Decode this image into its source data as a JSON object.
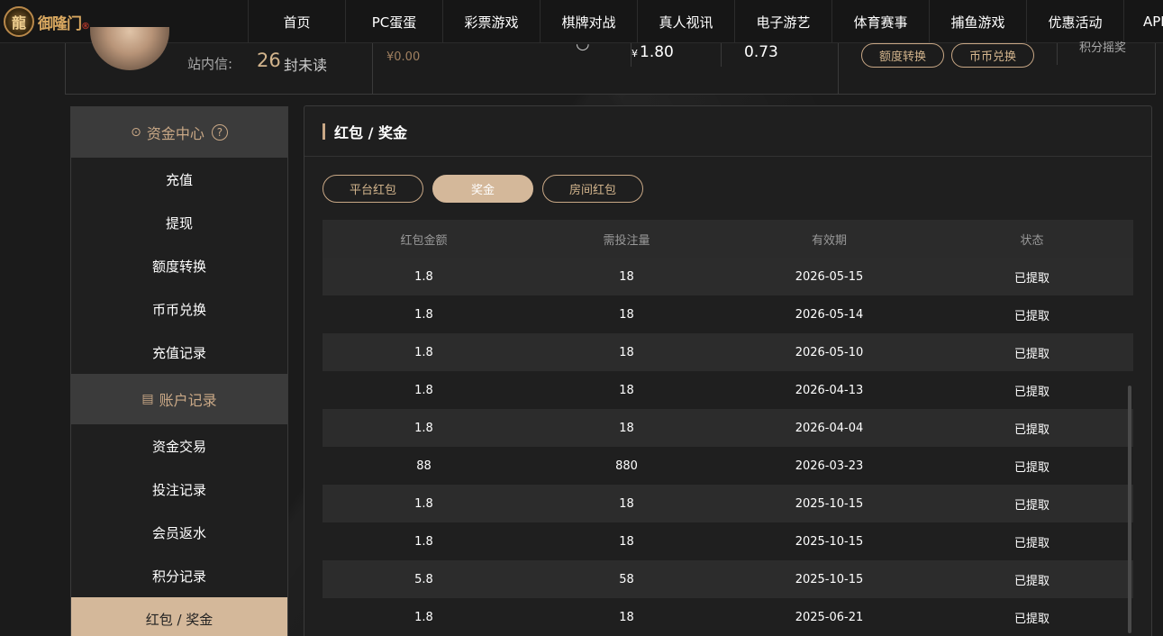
{
  "logo": {
    "mark": "龍",
    "text": "御隆门",
    "tag": "®"
  },
  "nav": [
    "首页",
    "PC蛋蛋",
    "彩票游戏",
    "棋牌对战",
    "真人视讯",
    "电子游艺",
    "体育赛事",
    "捕鱼游戏",
    "优惠活动",
    "APP"
  ],
  "account": {
    "msg_label": "站内信:",
    "msg_count": "26",
    "msg_unread": "封未读",
    "balance_left": "¥0.00",
    "balance_mid_symbol": "¥",
    "balance_mid": "1.80",
    "balance_right": "0.73",
    "btn_transfer": "额度转换",
    "btn_exchange": "币币兑换",
    "points_label": "积分摇奖"
  },
  "sidebar": {
    "fund_center": "资金中心",
    "help": "?",
    "fund_items": [
      "充值",
      "提现",
      "额度转换",
      "币币兑换",
      "充值记录"
    ],
    "account_records": "账户记录",
    "record_items": [
      "资金交易",
      "投注记录",
      "会员返水",
      "积分记录",
      "红包 / 奖金"
    ]
  },
  "panel": {
    "title": "红包 / 奖金",
    "tabs": [
      "平台红包",
      "奖金",
      "房间红包"
    ],
    "active_tab": "奖金",
    "columns": [
      "红包金额",
      "需投注量",
      "有效期",
      "状态"
    ],
    "rows": [
      [
        "1.8",
        "18",
        "2026-05-15",
        "已提取"
      ],
      [
        "1.8",
        "18",
        "2026-05-14",
        "已提取"
      ],
      [
        "1.8",
        "18",
        "2026-05-10",
        "已提取"
      ],
      [
        "1.8",
        "18",
        "2026-04-13",
        "已提取"
      ],
      [
        "1.8",
        "18",
        "2026-04-04",
        "已提取"
      ],
      [
        "88",
        "880",
        "2026-03-23",
        "已提取"
      ],
      [
        "1.8",
        "18",
        "2025-10-15",
        "已提取"
      ],
      [
        "1.8",
        "18",
        "2025-10-15",
        "已提取"
      ],
      [
        "5.8",
        "58",
        "2025-10-15",
        "已提取"
      ],
      [
        "1.8",
        "18",
        "2025-06-21",
        "已提取"
      ]
    ]
  },
  "colors": {
    "accent": "#d4b89a",
    "gold_text": "#c9a886",
    "bg": "#1b1b1b"
  }
}
